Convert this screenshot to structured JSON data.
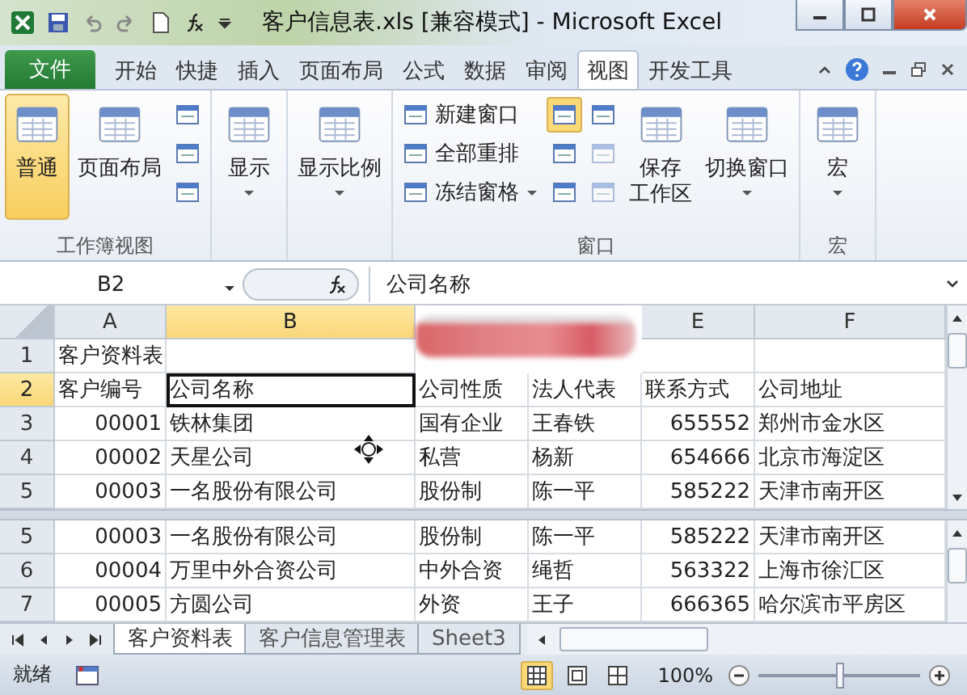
{
  "window": {
    "title": "客户信息表.xls  [兼容模式]  -  Microsoft Excel"
  },
  "ribbon_tabs": [
    {
      "label": "文件",
      "kind": "file",
      "selected": false
    },
    {
      "label": "开始",
      "kind": "tab",
      "selected": false
    },
    {
      "label": "快捷",
      "kind": "tab",
      "selected": false
    },
    {
      "label": "插入",
      "kind": "tab",
      "selected": false
    },
    {
      "label": "页面布局",
      "kind": "tab",
      "selected": false
    },
    {
      "label": "公式",
      "kind": "tab",
      "selected": false
    },
    {
      "label": "数据",
      "kind": "tab",
      "selected": false
    },
    {
      "label": "审阅",
      "kind": "tab",
      "selected": false
    },
    {
      "label": "视图",
      "kind": "tab",
      "selected": true
    },
    {
      "label": "开发工具",
      "kind": "tab",
      "selected": false
    }
  ],
  "ribbon_groups": [
    {
      "label": "工作簿视图",
      "items": [
        {
          "kind": "large",
          "label": "普通",
          "selected": true,
          "dropdown": false
        },
        {
          "kind": "large",
          "label": "页面布局",
          "selected": false,
          "dropdown": false
        },
        {
          "kind": "stack",
          "entries": [
            {
              "selected": false,
              "disabled": false,
              "dropdown": false
            },
            {
              "selected": false,
              "disabled": false,
              "dropdown": false
            },
            {
              "selected": false,
              "disabled": false,
              "dropdown": false
            }
          ]
        }
      ]
    },
    {
      "items": [
        {
          "kind": "large",
          "label": "显示",
          "selected": false,
          "dropdown": true
        }
      ]
    },
    {
      "items": [
        {
          "kind": "large",
          "label": "显示比例",
          "selected": false,
          "dropdown": true
        }
      ]
    },
    {
      "label": "窗口",
      "items": [
        {
          "kind": "stack",
          "entries": [
            {
              "label": "新建窗口",
              "selected": false,
              "disabled": false,
              "dropdown": false
            },
            {
              "label": "全部重排",
              "selected": false,
              "disabled": false,
              "dropdown": false
            },
            {
              "label": "冻结窗格",
              "selected": false,
              "disabled": false,
              "dropdown": true
            }
          ]
        },
        {
          "kind": "stack",
          "entries": [
            {
              "selected": true,
              "disabled": false,
              "dropdown": false
            },
            {
              "selected": false,
              "disabled": false,
              "dropdown": false
            },
            {
              "selected": false,
              "disabled": false,
              "dropdown": false
            }
          ]
        },
        {
          "kind": "stack",
          "entries": [
            {
              "selected": false,
              "disabled": false,
              "dropdown": false
            },
            {
              "selected": false,
              "disabled": true,
              "dropdown": false
            },
            {
              "selected": false,
              "disabled": true,
              "dropdown": false
            }
          ]
        },
        {
          "kind": "large",
          "label": [
            "保存",
            "工作区"
          ],
          "selected": false,
          "dropdown": false
        },
        {
          "kind": "large",
          "label": "切换窗口",
          "selected": false,
          "dropdown": true
        }
      ]
    },
    {
      "label": "宏",
      "items": [
        {
          "kind": "large",
          "label": "宏",
          "selected": false,
          "dropdown": true
        }
      ]
    }
  ],
  "formula_bar": {
    "name_box": "B2",
    "value": "公司名称"
  },
  "columns": [
    {
      "letter": "A",
      "selected": false
    },
    {
      "letter": "B",
      "selected": true
    },
    null,
    null,
    {
      "letter": "E",
      "selected": false
    },
    {
      "letter": "F",
      "selected": false
    }
  ],
  "top_pane_rows": [
    {
      "number": "1",
      "selected": false,
      "cells": [
        {
          "kind": "text",
          "text": "客户资料表",
          "selected": false
        },
        null,
        null,
        null,
        null,
        null
      ]
    },
    {
      "number": "2",
      "selected": true,
      "cells": [
        {
          "kind": "text",
          "text": "客户编号",
          "selected": false
        },
        {
          "kind": "text",
          "text": "公司名称",
          "selected": true
        },
        {
          "kind": "text",
          "text": "公司性质",
          "selected": false
        },
        {
          "kind": "text",
          "text": "法人代表",
          "selected": false
        },
        {
          "kind": "text",
          "text": "联系方式",
          "selected": false
        },
        {
          "kind": "text",
          "text": "公司地址",
          "selected": false
        }
      ]
    },
    {
      "number": "3",
      "selected": false,
      "cells": [
        {
          "kind": "number",
          "text": "00001",
          "selected": false
        },
        {
          "kind": "text",
          "text": "铁林集团",
          "selected": false
        },
        {
          "kind": "text",
          "text": "国有企业",
          "selected": false
        },
        {
          "kind": "text",
          "text": "王春铁",
          "selected": false
        },
        {
          "kind": "number",
          "text": "655552",
          "selected": false
        },
        {
          "kind": "text",
          "text": "郑州市金水区",
          "selected": false
        }
      ]
    },
    {
      "number": "4",
      "selected": false,
      "cells": [
        {
          "kind": "number",
          "text": "00002",
          "selected": false
        },
        {
          "kind": "text",
          "text": "天星公司",
          "selected": false
        },
        {
          "kind": "text",
          "text": "私营",
          "selected": false
        },
        {
          "kind": "text",
          "text": "杨新",
          "selected": false
        },
        {
          "kind": "number",
          "text": "654666",
          "selected": false
        },
        {
          "kind": "text",
          "text": "北京市海淀区",
          "selected": false
        }
      ]
    },
    {
      "number": "5",
      "selected": false,
      "cells": [
        {
          "kind": "number",
          "text": "00003",
          "selected": false
        },
        {
          "kind": "text",
          "text": "一名股份有限公司",
          "selected": false
        },
        {
          "kind": "text",
          "text": "股份制",
          "selected": false
        },
        {
          "kind": "text",
          "text": "陈一平",
          "selected": false
        },
        {
          "kind": "number",
          "text": "585222",
          "selected": false
        },
        {
          "kind": "text",
          "text": "天津市南开区",
          "selected": false
        }
      ]
    }
  ],
  "bottom_pane_rows": [
    {
      "number": "5",
      "selected": false,
      "cells": [
        {
          "kind": "number",
          "text": "00003",
          "selected": false
        },
        {
          "kind": "text",
          "text": "一名股份有限公司",
          "selected": false
        },
        {
          "kind": "text",
          "text": "股份制",
          "selected": false
        },
        {
          "kind": "text",
          "text": "陈一平",
          "selected": false
        },
        {
          "kind": "number",
          "text": "585222",
          "selected": false
        },
        {
          "kind": "text",
          "text": "天津市南开区",
          "selected": false
        }
      ]
    },
    {
      "number": "6",
      "selected": false,
      "cells": [
        {
          "kind": "number",
          "text": "00004",
          "selected": false
        },
        {
          "kind": "text",
          "text": "万里中外合资公司",
          "selected": false
        },
        {
          "kind": "text",
          "text": "中外合资",
          "selected": false
        },
        {
          "kind": "text",
          "text": "绳哲",
          "selected": false
        },
        {
          "kind": "number",
          "text": "563322",
          "selected": false
        },
        {
          "kind": "text",
          "text": "上海市徐汇区",
          "selected": false
        }
      ]
    },
    {
      "number": "7",
      "selected": false,
      "cells": [
        {
          "kind": "number",
          "text": "00005",
          "selected": false
        },
        {
          "kind": "text",
          "text": "方圆公司",
          "selected": false
        },
        {
          "kind": "text",
          "text": "外资",
          "selected": false
        },
        {
          "kind": "text",
          "text": "王子",
          "selected": false
        },
        {
          "kind": "number",
          "text": "666365",
          "selected": false
        },
        {
          "kind": "text",
          "text": "哈尔滨市平房区",
          "selected": false
        }
      ]
    }
  ],
  "sheet_tabs": [
    {
      "label": "客户资料表",
      "selected": true
    },
    {
      "label": "客户信息管理表",
      "selected": false
    },
    {
      "label": "Sheet3",
      "selected": false
    }
  ],
  "status_bar": {
    "status": "就绪",
    "views": [
      {
        "selected": true
      },
      {
        "selected": false
      },
      {
        "selected": false
      }
    ],
    "zoom": "100%",
    "zoom_slider": {
      "level": 0.5
    }
  }
}
